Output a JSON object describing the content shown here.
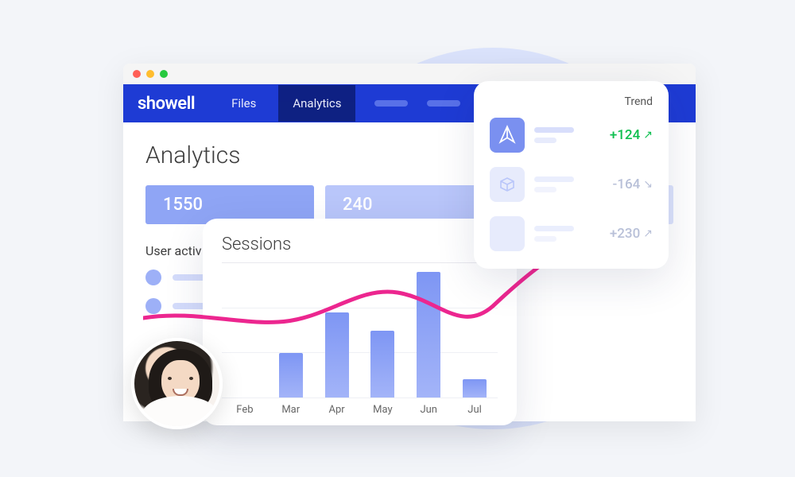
{
  "brand": "showell",
  "nav": {
    "items": [
      "Files",
      "Analytics"
    ],
    "active_index": 1
  },
  "page": {
    "title": "Analytics",
    "stats": [
      "1550",
      "240"
    ],
    "user_activity_label": "User activ"
  },
  "sessions": {
    "title": "Sessions"
  },
  "trend": {
    "header": "Trend",
    "rows": [
      {
        "value": "+124",
        "direction": "up",
        "class": "positive"
      },
      {
        "value": "-164",
        "direction": "down",
        "class": "neutral"
      },
      {
        "value": "+230",
        "direction": "up",
        "class": "neutral"
      }
    ]
  },
  "chart_data": {
    "type": "bar",
    "title": "Sessions",
    "categories": [
      "Feb",
      "Mar",
      "Apr",
      "May",
      "Jun",
      "Jul"
    ],
    "values": [
      0,
      50,
      95,
      75,
      140,
      20
    ],
    "ylim": [
      0,
      150
    ],
    "overlay_line": {
      "type": "line",
      "description": "pink trend line overlay",
      "color": "#ec268f"
    }
  },
  "colors": {
    "nav_bg": "#1e3bd4",
    "nav_active": "#0d1f7a",
    "accent_line": "#ec268f",
    "positive": "#0dbf4f"
  }
}
